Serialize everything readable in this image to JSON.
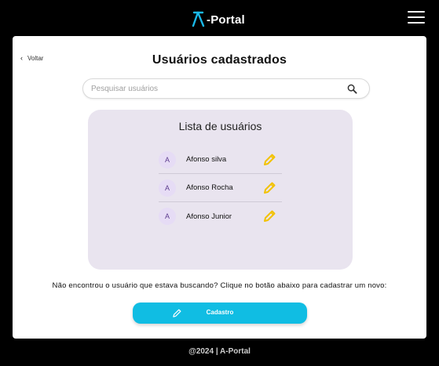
{
  "header": {
    "logo_text": "-Portal",
    "menu_icon": "hamburger-menu-icon"
  },
  "nav": {
    "back_label": "Voltar",
    "back_icon": "chevron-left-icon"
  },
  "page": {
    "title": "Usuários cadastrados"
  },
  "search": {
    "placeholder": "Pesquisar usuários",
    "value": "",
    "icon": "search-icon"
  },
  "user_list": {
    "title": "Lista de usuários",
    "items": [
      {
        "initial": "A",
        "name": "Afonso silva",
        "action_icon": "pencil-edit-icon"
      },
      {
        "initial": "A",
        "name": "Afonso Rocha",
        "action_icon": "pencil-edit-icon"
      },
      {
        "initial": "A",
        "name": "Afonso Junior",
        "action_icon": "pencil-edit-icon"
      }
    ]
  },
  "hint_text": "Não encontrou o usuário que estava buscando? Clique no botão abaixo para cadastrar um novo:",
  "cadastro_button": {
    "label": "Cadastro",
    "icon": "pencil-icon"
  },
  "footer": {
    "text": "@2024 | A-Portal"
  },
  "colors": {
    "background": "#000000",
    "card": "#ffffff",
    "accent": "#10bde3",
    "logo_accent": "#1ab8e8",
    "list_panel": "#e9e4ef",
    "avatar_bg": "#e6dcf5",
    "avatar_text": "#5e3d8f",
    "edit_icon": "#f2c200"
  }
}
